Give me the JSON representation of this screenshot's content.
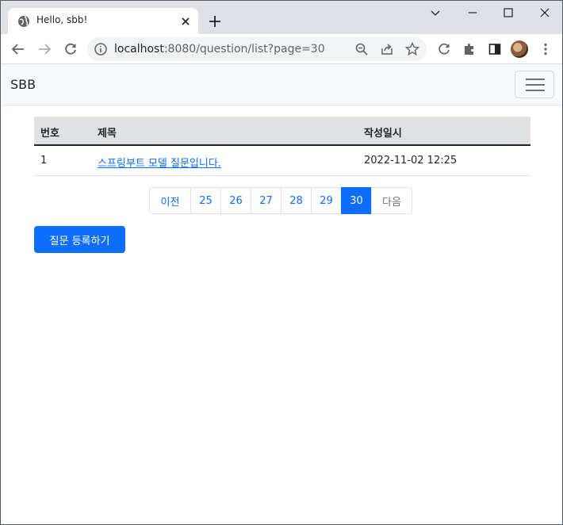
{
  "browser": {
    "tab_title": "Hello, sbb!",
    "url_host": "localhost",
    "url_rest": ":8080/question/list?page=30"
  },
  "navbar": {
    "brand": "SBB"
  },
  "table": {
    "headers": [
      "번호",
      "제목",
      "작성일시"
    ],
    "rows": [
      {
        "no": "1",
        "subject": "스프링부트 모델 질문입니다.",
        "date": "2022-11-02 12:25"
      }
    ]
  },
  "pagination": {
    "prev": "이전",
    "pages": [
      "25",
      "26",
      "27",
      "28",
      "29",
      "30"
    ],
    "active": "30",
    "next": "다음"
  },
  "actions": {
    "create_question": "질문 등록하기"
  },
  "colors": {
    "primary": "#0d6efd",
    "header_bg": "#e0e1e2",
    "tabstrip": "#dee1e6"
  }
}
